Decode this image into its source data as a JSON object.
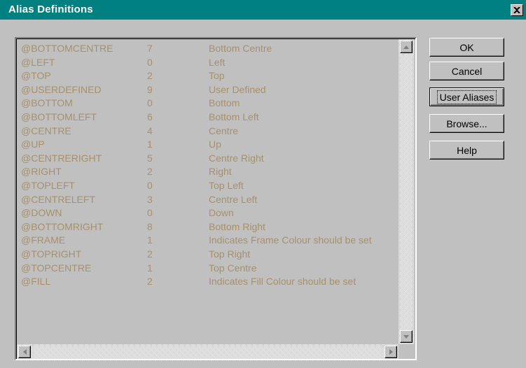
{
  "window": {
    "title": "Alias Definitions",
    "close_glyph": "✕"
  },
  "aliases": [
    {
      "name": "@BOTTOMCENTRE",
      "value": "7",
      "description": "Bottom Centre"
    },
    {
      "name": "@LEFT",
      "value": "0",
      "description": "Left"
    },
    {
      "name": "@TOP",
      "value": "2",
      "description": "Top"
    },
    {
      "name": "@USERDEFINED",
      "value": "9",
      "description": "User Defined"
    },
    {
      "name": "@BOTTOM",
      "value": "0",
      "description": "Bottom"
    },
    {
      "name": "@BOTTOMLEFT",
      "value": "6",
      "description": "Bottom Left"
    },
    {
      "name": "@CENTRE",
      "value": "4",
      "description": "Centre"
    },
    {
      "name": "@UP",
      "value": "1",
      "description": "Up"
    },
    {
      "name": "@CENTRERIGHT",
      "value": "5",
      "description": "Centre Right"
    },
    {
      "name": "@RIGHT",
      "value": "2",
      "description": "Right"
    },
    {
      "name": "@TOPLEFT",
      "value": "0",
      "description": "Top Left"
    },
    {
      "name": "@CENTRELEFT",
      "value": "3",
      "description": "Centre Left"
    },
    {
      "name": "@DOWN",
      "value": "0",
      "description": "Down"
    },
    {
      "name": "@BOTTOMRIGHT",
      "value": "8",
      "description": "Bottom Right"
    },
    {
      "name": "@FRAME",
      "value": "1",
      "description": "Indicates Frame Colour should be set"
    },
    {
      "name": "@TOPRIGHT",
      "value": "2",
      "description": "Top Right"
    },
    {
      "name": "@TOPCENTRE",
      "value": "1",
      "description": "Top Centre"
    },
    {
      "name": "@FILL",
      "value": "2",
      "description": "Indicates Fill Colour should be set"
    }
  ],
  "buttons": {
    "ok": "OK",
    "cancel": "Cancel",
    "user_aliases": "User Aliases",
    "browse": "Browse...",
    "help": "Help"
  },
  "colors": {
    "titlebar": "#008080",
    "list_text": "#a7906c",
    "face": "#c0c0c0"
  },
  "icons": {
    "scroll_up": "arrow-up-icon",
    "scroll_down": "arrow-down-icon",
    "scroll_left": "arrow-left-icon",
    "scroll_right": "arrow-right-icon",
    "close": "close-icon"
  }
}
